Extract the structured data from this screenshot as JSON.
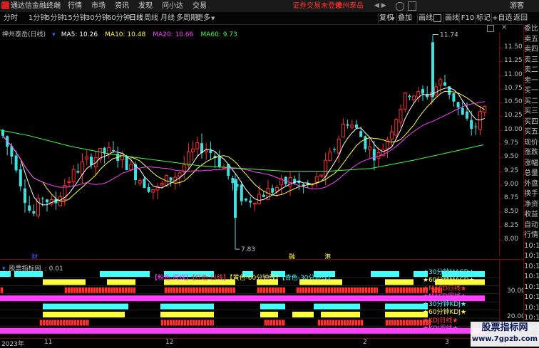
{
  "menubar": {
    "app_title": "通达信金融终端",
    "menus": [
      "行情",
      "市场",
      "资讯",
      "发现",
      "问小达",
      "交易"
    ],
    "alert": "证券交易未登录",
    "stock_name": "神州泰岳",
    "right_label": "游客"
  },
  "toolbar": {
    "timeframes": [
      "分时",
      "1分钟",
      "5分钟",
      "15分钟",
      "30分钟",
      "60分钟",
      "日线",
      "周线",
      "月线",
      "多周期",
      "更多"
    ],
    "active_timeframe": "日线",
    "right_buttons": [
      "复权",
      "叠加",
      "画线",
      "F10",
      "标记",
      "+自选",
      "返回"
    ]
  },
  "main_chart": {
    "title": "神州泰岳(日线)",
    "ma_labels": [
      {
        "text": "MA5: 10.26",
        "color": "#ffffff"
      },
      {
        "text": "MA10: 10.48",
        "color": "#ffff40"
      },
      {
        "text": "MA20: 10.66",
        "color": "#ff40ff"
      },
      {
        "text": "MA60: 9.73",
        "color": "#40ff40"
      }
    ],
    "high_label": "11.74",
    "low_label": "7.83",
    "event_markers": [
      {
        "text": "财",
        "color": "#4060ff"
      },
      {
        "text": "融",
        "color": "#ffff40"
      },
      {
        "text": "港",
        "color": "#ffff40"
      }
    ],
    "price_ticks": [
      "11.50",
      "11.25",
      "11.00",
      "10.75",
      "10.50",
      "10.25",
      "10.00",
      "9.75",
      "9.50",
      "9.25",
      "9.00",
      "8.75",
      "8.50",
      "8.25",
      "8.00"
    ]
  },
  "indicator": {
    "title": "股票指标网",
    "value": ": 0.01",
    "legend": [
      {
        "text": "【粉色-周线】",
        "color": "#ff40ff"
      },
      {
        "text": "【红色-日线】",
        "color": "#ff4040"
      },
      {
        "text": "【黄色-60分钟线】",
        "color": "#ffff40"
      },
      {
        "text": "【青色-30分钟线】",
        "color": "#40ffff"
      }
    ],
    "row_tags": [
      {
        "text": "★30分钟MACD★",
        "color": "#40ffff"
      },
      {
        "text": "★60分钟MACD★",
        "color": "#ffff40"
      },
      {
        "text": "★MACD日线★",
        "color": "#ff4040"
      },
      {
        "text": "★MACD周线★",
        "color": "#ff40ff"
      },
      {
        "text": "★30分钟KDJ★",
        "color": "#40ffff"
      },
      {
        "text": "★60分钟KDJ★",
        "color": "#ffff40"
      },
      {
        "text": "★KDJ日线★",
        "color": "#ff4040"
      },
      {
        "text": "★KDJ周线★",
        "color": "#ff40ff"
      }
    ],
    "axis_ticks": [
      "30.00",
      "20.00"
    ],
    "date_labels": [
      "2023年",
      "11",
      "12",
      "2",
      "3"
    ]
  },
  "side_panel": {
    "items": [
      "委比",
      "卖五",
      "卖四",
      "卖三",
      "卖二",
      "卖一",
      "买一",
      "买二",
      "买三",
      "买四",
      "买五",
      "现价",
      "涨跌",
      "涨幅",
      "总量",
      "外盘",
      "换手",
      "净资",
      "收益",
      "自动",
      "行情"
    ],
    "time_items": [
      "10:1",
      "10:1",
      "10:1",
      "10:1",
      "10:1",
      "10:1",
      "10:1",
      "10:1",
      "10:1",
      "10:1",
      "10:1"
    ]
  },
  "watermark": {
    "line1": "股票指标网",
    "line2": "www.7gpzb.com"
  },
  "colors": {
    "up": "#ff3030",
    "down": "#40e0e0",
    "ma5": "#ffffff",
    "ma10": "#ffff40",
    "ma20": "#ff40ff",
    "ma60": "#40ff40"
  }
}
